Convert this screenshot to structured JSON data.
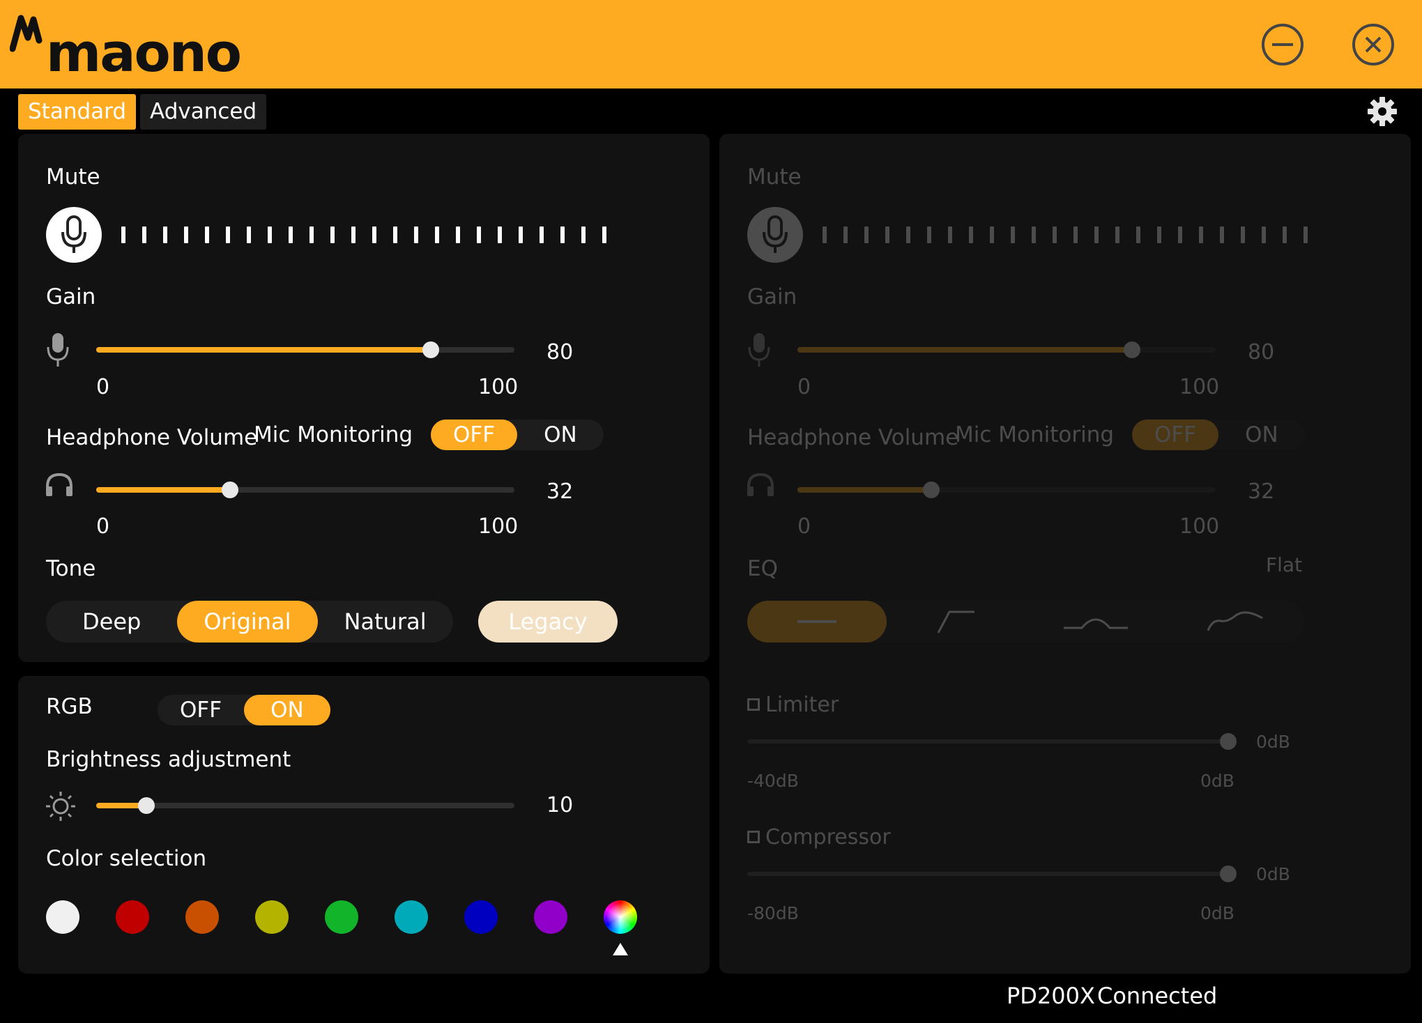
{
  "app": {
    "brand": "maono",
    "accent": "#ffab21"
  },
  "tabs": [
    "Standard",
    "Advanced"
  ],
  "left": {
    "mute": {
      "label": "Mute"
    },
    "gain": {
      "label": "Gain",
      "value": "80",
      "min": "0",
      "max": "100",
      "level": 0.8
    },
    "headphone": {
      "label": "Headphone Volume",
      "value": "32",
      "min": "0",
      "max": "100",
      "level": 0.32
    },
    "monitoring": {
      "label": "Mic Monitoring",
      "off": "OFF",
      "on": "ON",
      "selected": "OFF"
    },
    "tone": {
      "label": "Tone",
      "options": [
        "Deep",
        "Original",
        "Natural"
      ],
      "selected": "Original",
      "legacy": "Legacy"
    }
  },
  "rgb": {
    "label": "RGB",
    "off": "OFF",
    "on": "ON",
    "selected": "ON",
    "brightness": {
      "label": "Brightness adjustment",
      "value": "10",
      "level": 0.12
    },
    "color_label": "Color selection",
    "colors": [
      "#f0f0f0",
      "#c00000",
      "#c85000",
      "#b4b400",
      "#12b42a",
      "#00aab8",
      "#0000c0",
      "#9000c8",
      "rainbow"
    ],
    "selected_index": 8
  },
  "right": {
    "mute": {
      "label": "Mute"
    },
    "gain": {
      "label": "Gain",
      "value": "80",
      "min": "0",
      "max": "100",
      "level": 0.8
    },
    "headphone": {
      "label": "Headphone Volume",
      "value": "32",
      "min": "0",
      "max": "100",
      "level": 0.32
    },
    "monitoring": {
      "label": "Mic Monitoring",
      "off": "OFF",
      "on": "ON",
      "selected": "OFF"
    },
    "eq": {
      "label": "EQ",
      "preset": "Flat",
      "presets": [
        "flat-icon",
        "highpass-icon",
        "bell-icon",
        "presence-icon"
      ]
    },
    "limiter": {
      "label": "Limiter",
      "value": "0dB",
      "min": "-40dB",
      "max": "0dB",
      "level": 1.0
    },
    "compressor": {
      "label": "Compressor",
      "value": "0dB",
      "min": "-80dB",
      "max": "0dB",
      "level": 1.0
    }
  },
  "status": {
    "device": "PD200X",
    "state": "Connected"
  }
}
